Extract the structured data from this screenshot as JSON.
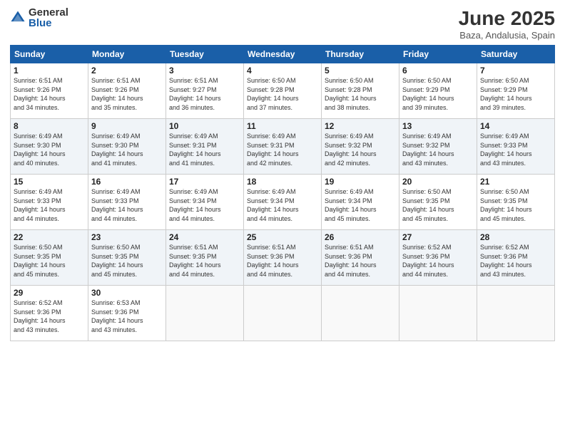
{
  "header": {
    "logo_general": "General",
    "logo_blue": "Blue",
    "month_title": "June 2025",
    "location": "Baza, Andalusia, Spain"
  },
  "weekdays": [
    "Sunday",
    "Monday",
    "Tuesday",
    "Wednesday",
    "Thursday",
    "Friday",
    "Saturday"
  ],
  "weeks": [
    [
      {
        "day": "1",
        "info": "Sunrise: 6:51 AM\nSunset: 9:26 PM\nDaylight: 14 hours\nand 34 minutes."
      },
      {
        "day": "2",
        "info": "Sunrise: 6:51 AM\nSunset: 9:26 PM\nDaylight: 14 hours\nand 35 minutes."
      },
      {
        "day": "3",
        "info": "Sunrise: 6:51 AM\nSunset: 9:27 PM\nDaylight: 14 hours\nand 36 minutes."
      },
      {
        "day": "4",
        "info": "Sunrise: 6:50 AM\nSunset: 9:28 PM\nDaylight: 14 hours\nand 37 minutes."
      },
      {
        "day": "5",
        "info": "Sunrise: 6:50 AM\nSunset: 9:28 PM\nDaylight: 14 hours\nand 38 minutes."
      },
      {
        "day": "6",
        "info": "Sunrise: 6:50 AM\nSunset: 9:29 PM\nDaylight: 14 hours\nand 39 minutes."
      },
      {
        "day": "7",
        "info": "Sunrise: 6:50 AM\nSunset: 9:29 PM\nDaylight: 14 hours\nand 39 minutes."
      }
    ],
    [
      {
        "day": "8",
        "info": "Sunrise: 6:49 AM\nSunset: 9:30 PM\nDaylight: 14 hours\nand 40 minutes."
      },
      {
        "day": "9",
        "info": "Sunrise: 6:49 AM\nSunset: 9:30 PM\nDaylight: 14 hours\nand 41 minutes."
      },
      {
        "day": "10",
        "info": "Sunrise: 6:49 AM\nSunset: 9:31 PM\nDaylight: 14 hours\nand 41 minutes."
      },
      {
        "day": "11",
        "info": "Sunrise: 6:49 AM\nSunset: 9:31 PM\nDaylight: 14 hours\nand 42 minutes."
      },
      {
        "day": "12",
        "info": "Sunrise: 6:49 AM\nSunset: 9:32 PM\nDaylight: 14 hours\nand 42 minutes."
      },
      {
        "day": "13",
        "info": "Sunrise: 6:49 AM\nSunset: 9:32 PM\nDaylight: 14 hours\nand 43 minutes."
      },
      {
        "day": "14",
        "info": "Sunrise: 6:49 AM\nSunset: 9:33 PM\nDaylight: 14 hours\nand 43 minutes."
      }
    ],
    [
      {
        "day": "15",
        "info": "Sunrise: 6:49 AM\nSunset: 9:33 PM\nDaylight: 14 hours\nand 44 minutes."
      },
      {
        "day": "16",
        "info": "Sunrise: 6:49 AM\nSunset: 9:33 PM\nDaylight: 14 hours\nand 44 minutes."
      },
      {
        "day": "17",
        "info": "Sunrise: 6:49 AM\nSunset: 9:34 PM\nDaylight: 14 hours\nand 44 minutes."
      },
      {
        "day": "18",
        "info": "Sunrise: 6:49 AM\nSunset: 9:34 PM\nDaylight: 14 hours\nand 44 minutes."
      },
      {
        "day": "19",
        "info": "Sunrise: 6:49 AM\nSunset: 9:34 PM\nDaylight: 14 hours\nand 45 minutes."
      },
      {
        "day": "20",
        "info": "Sunrise: 6:50 AM\nSunset: 9:35 PM\nDaylight: 14 hours\nand 45 minutes."
      },
      {
        "day": "21",
        "info": "Sunrise: 6:50 AM\nSunset: 9:35 PM\nDaylight: 14 hours\nand 45 minutes."
      }
    ],
    [
      {
        "day": "22",
        "info": "Sunrise: 6:50 AM\nSunset: 9:35 PM\nDaylight: 14 hours\nand 45 minutes."
      },
      {
        "day": "23",
        "info": "Sunrise: 6:50 AM\nSunset: 9:35 PM\nDaylight: 14 hours\nand 45 minutes."
      },
      {
        "day": "24",
        "info": "Sunrise: 6:51 AM\nSunset: 9:35 PM\nDaylight: 14 hours\nand 44 minutes."
      },
      {
        "day": "25",
        "info": "Sunrise: 6:51 AM\nSunset: 9:36 PM\nDaylight: 14 hours\nand 44 minutes."
      },
      {
        "day": "26",
        "info": "Sunrise: 6:51 AM\nSunset: 9:36 PM\nDaylight: 14 hours\nand 44 minutes."
      },
      {
        "day": "27",
        "info": "Sunrise: 6:52 AM\nSunset: 9:36 PM\nDaylight: 14 hours\nand 44 minutes."
      },
      {
        "day": "28",
        "info": "Sunrise: 6:52 AM\nSunset: 9:36 PM\nDaylight: 14 hours\nand 43 minutes."
      }
    ],
    [
      {
        "day": "29",
        "info": "Sunrise: 6:52 AM\nSunset: 9:36 PM\nDaylight: 14 hours\nand 43 minutes."
      },
      {
        "day": "30",
        "info": "Sunrise: 6:53 AM\nSunset: 9:36 PM\nDaylight: 14 hours\nand 43 minutes."
      },
      {
        "day": "",
        "info": ""
      },
      {
        "day": "",
        "info": ""
      },
      {
        "day": "",
        "info": ""
      },
      {
        "day": "",
        "info": ""
      },
      {
        "day": "",
        "info": ""
      }
    ]
  ]
}
